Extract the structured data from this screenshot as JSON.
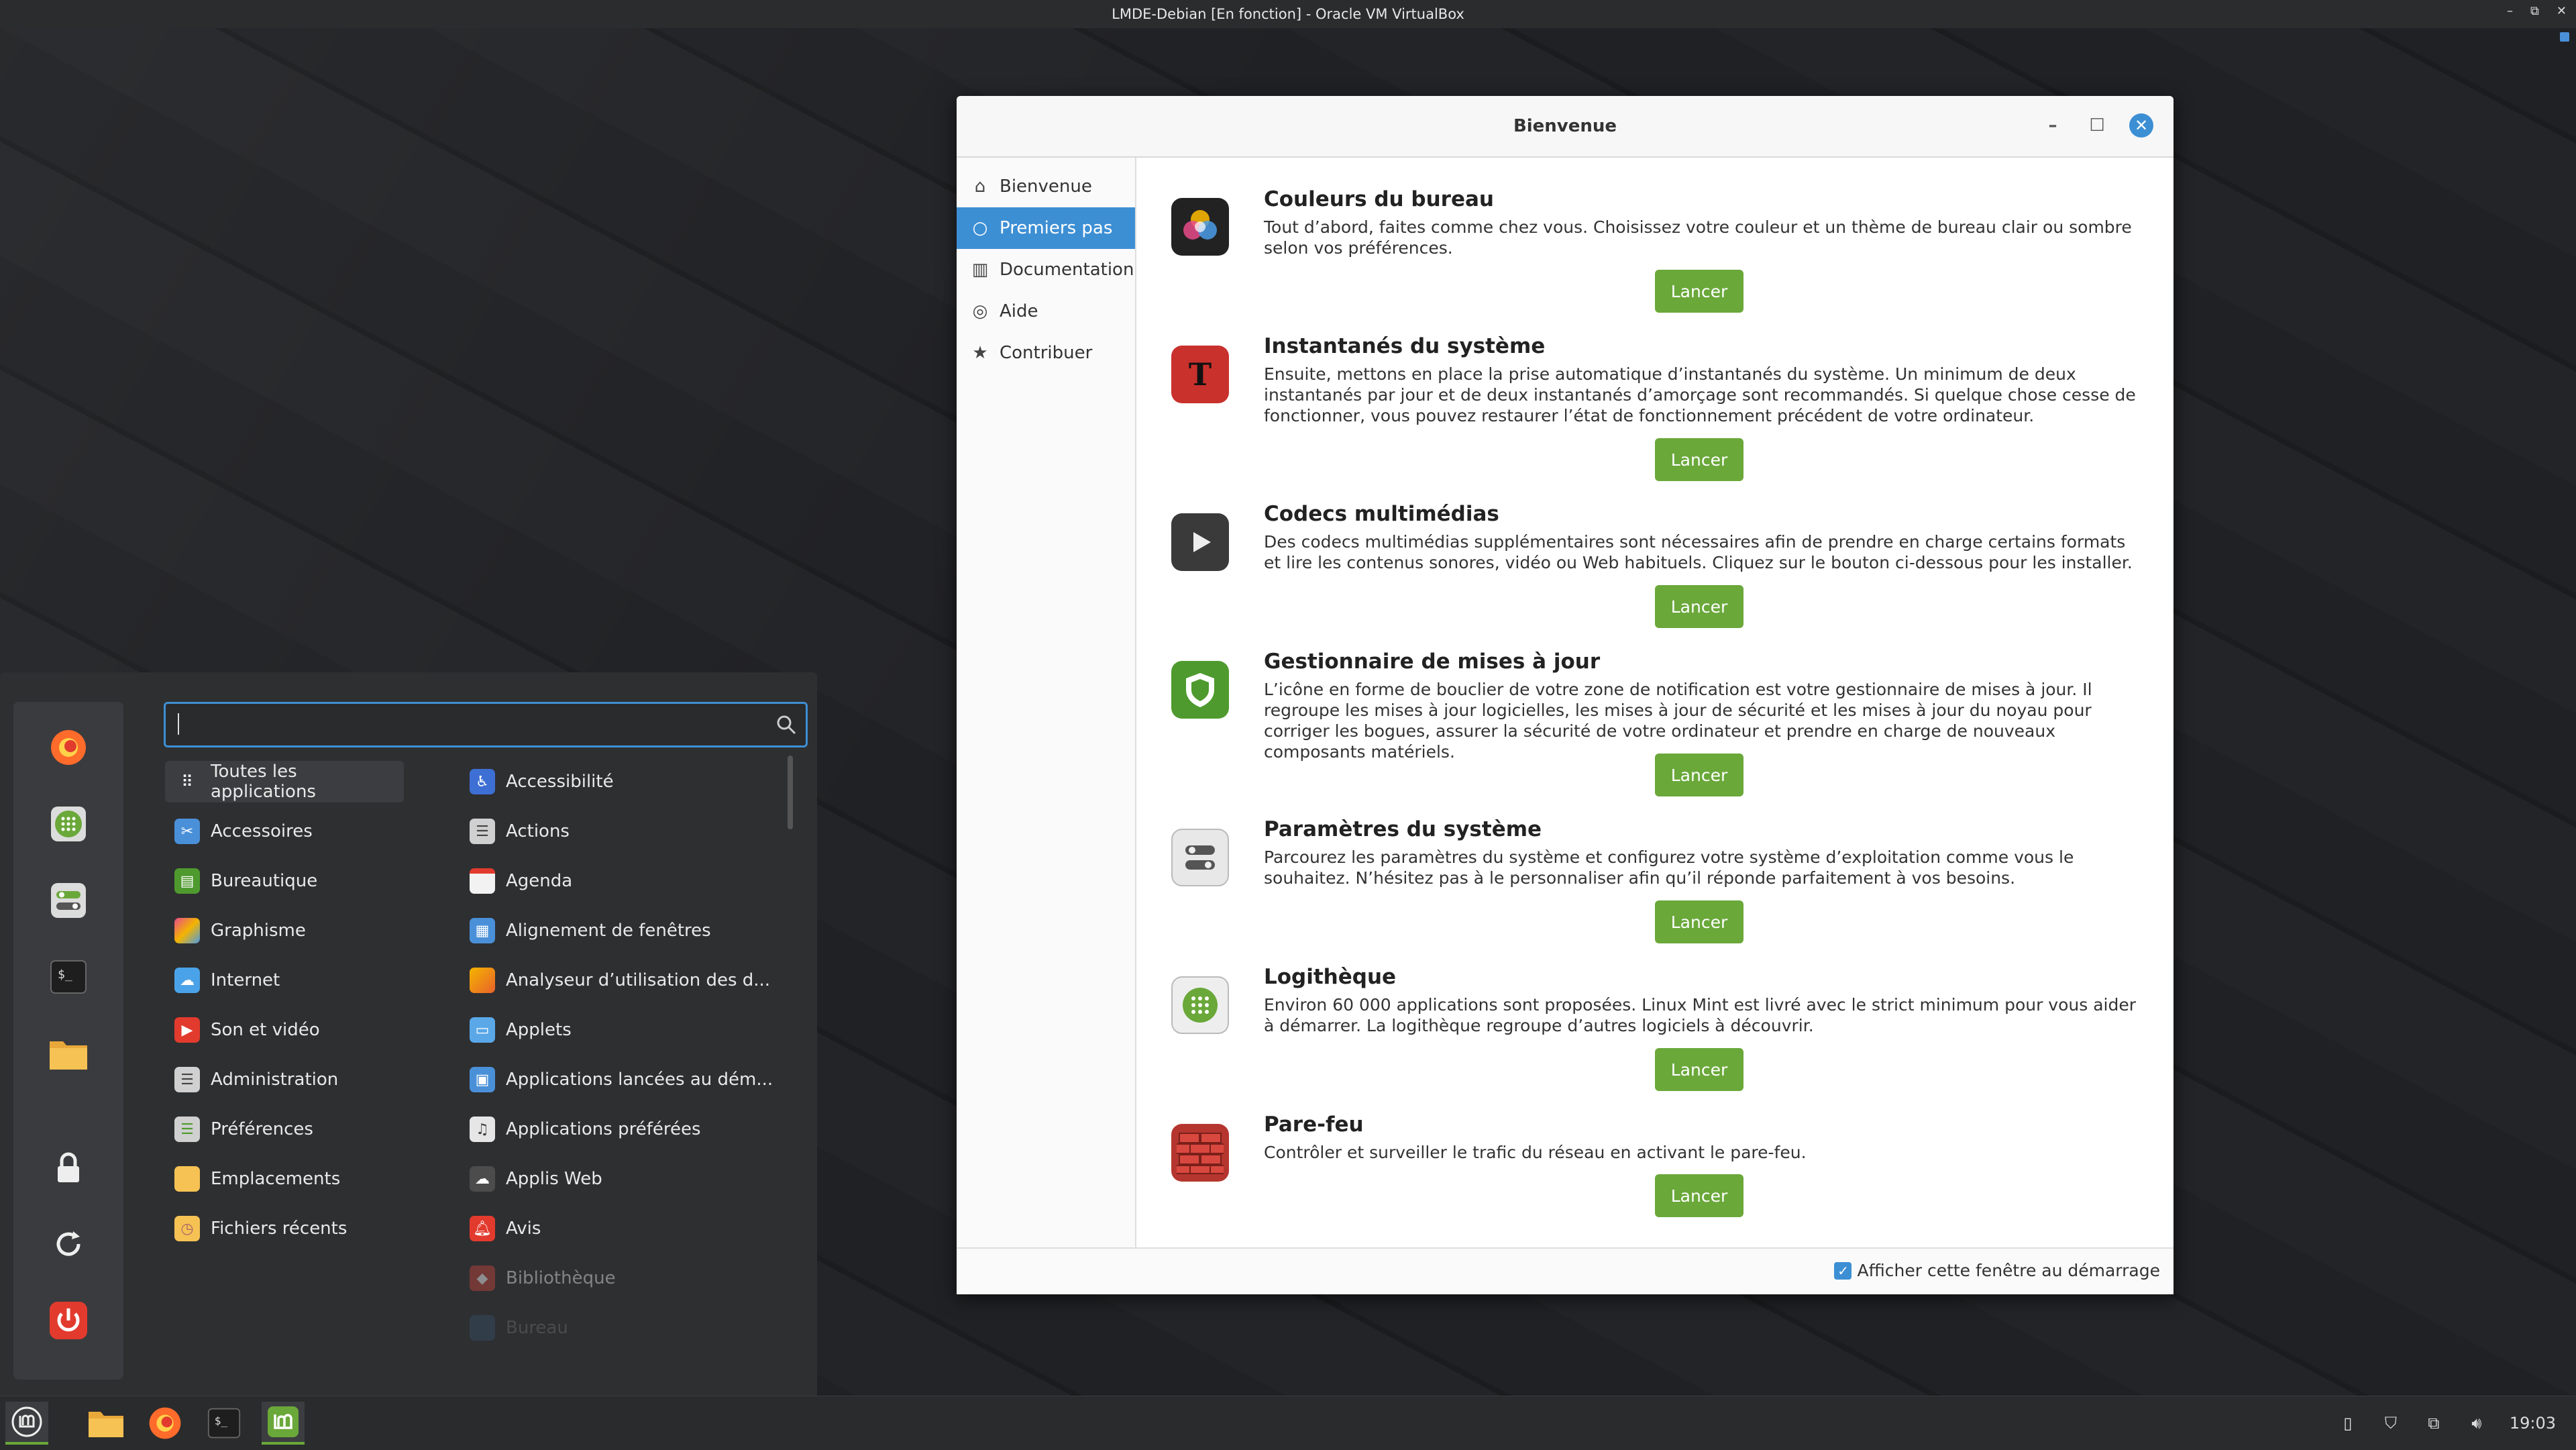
{
  "vbox": {
    "title": "LMDE-Debian [En fonction] - Oracle VM VirtualBox"
  },
  "welcome": {
    "title": "Bienvenue",
    "sidebar": [
      {
        "label": "Bienvenue",
        "icon": "home-icon"
      },
      {
        "label": "Premiers pas",
        "icon": "lightbulb-icon"
      },
      {
        "label": "Documentation",
        "icon": "book-icon"
      },
      {
        "label": "Aide",
        "icon": "lifebuoy-icon"
      },
      {
        "label": "Contribuer",
        "icon": "star-icon"
      }
    ],
    "features": [
      {
        "title": "Couleurs du bureau",
        "desc": "Tout d’abord, faites comme chez vous. Choisissez votre couleur et un thème de bureau clair ou sombre selon vos préférences.",
        "button": "Lancer",
        "icon": "color-wheel-icon"
      },
      {
        "title": "Instantanés du système",
        "desc": "Ensuite, mettons en place la prise automatique d’instantanés du système. Un minimum de deux instantanés par jour et de deux instantanés d’amorçage sont recommandés. Si quelque chose cesse de fonctionner, vous pouvez restaurer l’état de fonctionnement précédent de votre ordinateur.",
        "button": "Lancer",
        "icon": "timeshift-icon"
      },
      {
        "title": "Codecs multimédias",
        "desc": "Des codecs multimédias supplémentaires sont nécessaires afin de prendre en charge certains formats et lire les contenus sonores, vidéo ou Web habituels. Cliquez sur le bouton ci-dessous pour les installer.",
        "button": "Lancer",
        "icon": "play-icon"
      },
      {
        "title": "Gestionnaire de mises à jour",
        "desc": "L’icône en forme de bouclier de votre zone de notification est votre gestionnaire de mises à jour. Il regroupe les mises à jour logicielles, les mises à jour de sécurité et les mises à jour du noyau pour corriger les bogues, assurer la sécurité de votre ordinateur et prendre en charge de nouveaux composants matériels.",
        "button": "Lancer",
        "icon": "shield-icon"
      },
      {
        "title": "Paramètres du système",
        "desc": "Parcourez les paramètres du système et configurez votre système d’exploitation comme vous le souhaitez. N’hésitez pas à le personnaliser afin qu’il réponde parfaitement à vos besoins.",
        "button": "Lancer",
        "icon": "settings-toggle-icon"
      },
      {
        "title": "Logithèque",
        "desc": "Environ 60 000 applications sont proposées. Linux Mint est livré avec le strict minimum pour vous aider à démarrer. La logithèque regroupe d’autres logiciels à découvrir.",
        "button": "Lancer",
        "icon": "software-manager-icon"
      },
      {
        "title": "Pare-feu",
        "desc": "Contrôler et surveiller le trafic du réseau en activant le pare-feu.",
        "button": "Lancer",
        "icon": "firewall-icon"
      }
    ],
    "footer": {
      "checkbox_label": "Afficher cette fenêtre au démarrage",
      "checked": true
    }
  },
  "menu": {
    "search_value": "",
    "categories": [
      "Toutes les applications",
      "Accessoires",
      "Bureautique",
      "Graphisme",
      "Internet",
      "Son et vidéo",
      "Administration",
      "Préférences",
      "Emplacements",
      "Fichiers récents"
    ],
    "apps": [
      "Accessibilité",
      "Actions",
      "Agenda",
      "Alignement de fenêtres",
      "Analyseur d’utilisation des d...",
      "Applets",
      "Applications lancées au dém...",
      "Applications préférées",
      "Applis Web",
      "Avis",
      "Bibliothèque",
      "Bureau"
    ],
    "favorites": [
      "firefox-icon",
      "software-manager-icon",
      "settings-icon",
      "terminal-icon",
      "folder-icon",
      "lock-icon",
      "restart-icon",
      "power-icon"
    ]
  },
  "taskbar": {
    "clock": "19:03",
    "apps": [
      "menu-icon",
      "folder-icon",
      "firefox-icon",
      "terminal-icon",
      "mintwelcome-icon"
    ]
  },
  "colors": {
    "accent": "#3d8fd4",
    "button_green": "#6aa83a"
  }
}
